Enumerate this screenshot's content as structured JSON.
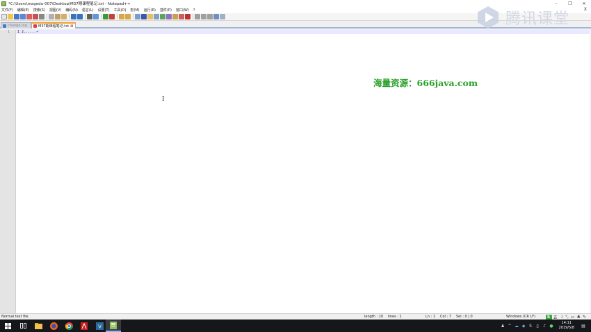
{
  "window": {
    "title": "*C:\\Users\\magedu-007\\Desktop\\M37期课程笔记.txt - Notepad++",
    "controls": [
      "–",
      "❐",
      "✕"
    ]
  },
  "menu": {
    "items": [
      "文件(F)",
      "编辑(E)",
      "搜索(S)",
      "视图(V)",
      "编码(N)",
      "语言(L)",
      "设置(T)",
      "工具(O)",
      "宏(M)",
      "运行(R)",
      "插件(P)",
      "窗口(W)",
      "?"
    ],
    "close": "X"
  },
  "toolbar": {
    "buttons": [
      "new-file",
      "open-file",
      "save",
      "save-all",
      "close",
      "close-all",
      "print",
      "cut",
      "copy",
      "paste",
      "undo",
      "redo",
      "find",
      "replace",
      "zoom-in",
      "zoom-out",
      "sync-v",
      "sync-h",
      "word-wrap",
      "show-all-chars",
      "indent-guide",
      "udl",
      "doc-map",
      "function-list",
      "folder-workspace",
      "monitor",
      "record-macro",
      "stop-macro",
      "play-macro",
      "run-macro-multiple",
      "save-macro"
    ]
  },
  "tabs": [
    {
      "label": "change.log",
      "active": false
    },
    {
      "label": "M37期课程笔记.txt",
      "active": true
    }
  ],
  "editor": {
    "line_number": "1",
    "line_text": "1  2......→",
    "watermark": "海量资源：666java.com"
  },
  "logo": {
    "text": "腾讯课堂"
  },
  "status": {
    "file_type": "Normal text file",
    "length": "length : 10",
    "lines": "lines : 1",
    "ln": "Ln : 1",
    "col": "Col : 7",
    "sel": "Sel : 0 | 0",
    "eol": "Windows (CR LF)",
    "ime_label": "五"
  },
  "taskbar": {
    "time": "14:11",
    "date": "2019/5/8"
  },
  "colors": {
    "accent_tab": "#f0a030",
    "watermark": "#2aa02a",
    "taskbar": "#16171b"
  }
}
